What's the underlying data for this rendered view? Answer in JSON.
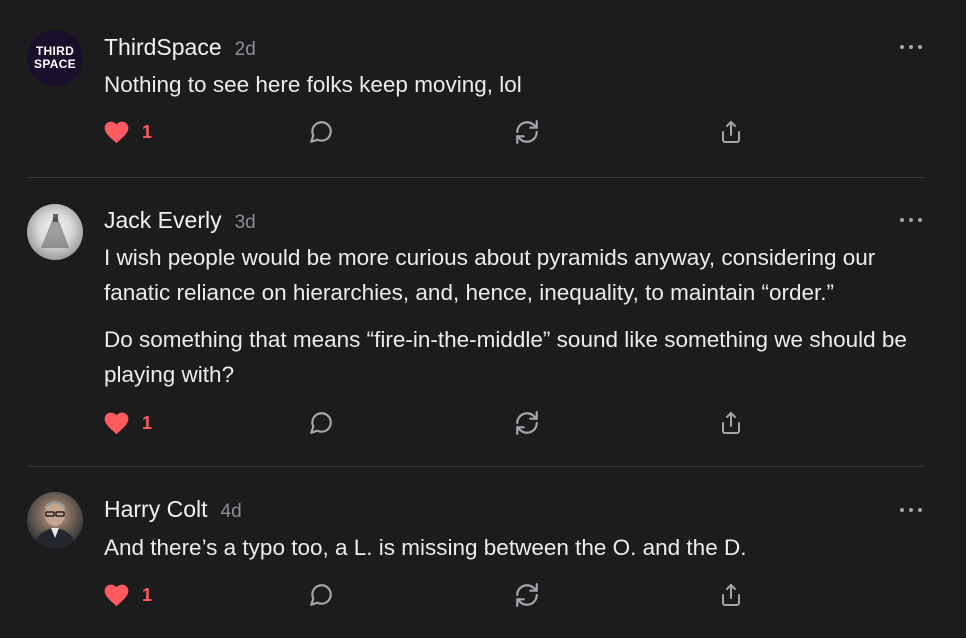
{
  "comments": [
    {
      "author": "ThirdSpace",
      "time": "2d",
      "avatar_text": [
        "THIRD",
        "SPACE"
      ],
      "paragraphs": [
        "Nothing to see here folks keep moving, lol"
      ],
      "likes": "1"
    },
    {
      "author": "Jack Everly",
      "time": "3d",
      "paragraphs": [
        "I wish people would be more curious about pyramids anyway, considering our fanatic reliance on hierarchies, and, hence, inequality, to maintain “order.”",
        "Do something that means “fire-in-the-middle” sound like something we should be playing with?"
      ],
      "likes": "1"
    },
    {
      "author": "Harry Colt",
      "time": "4d",
      "paragraphs": [
        "And there’s a typo too, a L. is missing between the O. and the D."
      ],
      "likes": "1"
    }
  ],
  "colors": {
    "background": "#1c1c1e",
    "like_accent": "#ff5a5f",
    "muted": "#8e8e93",
    "icon": "#a5a5aa",
    "divider": "#38383b"
  },
  "icons": {
    "like": "heart-icon",
    "reply": "speech-bubble-icon",
    "restack": "refresh-arrows-icon",
    "share": "share-upload-icon",
    "more": "ellipsis-icon"
  }
}
